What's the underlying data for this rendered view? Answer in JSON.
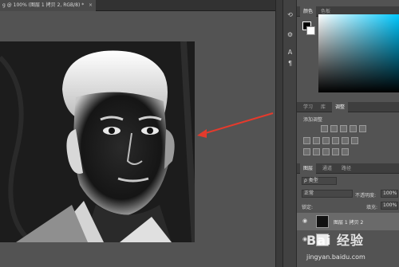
{
  "document": {
    "tab_title": "g @ 100% (图层 1 拷贝 2, RGB/8) *",
    "close_glyph": "×"
  },
  "colors": {
    "accent_arrow": "#e53a2c",
    "workspace": "#535353",
    "panel_dark": "#3e3e3e"
  },
  "color_panel": {
    "tabs": [
      "颜色",
      "色板"
    ],
    "active_tab": 0
  },
  "adjust_panel": {
    "tabs": [
      "学习",
      "库",
      "调整"
    ],
    "active_tab": 2,
    "add_label": "添加调整"
  },
  "layers_panel": {
    "tabs": [
      "图层",
      "通道",
      "路径"
    ],
    "active_tab": 0,
    "filter_label": "ρ 类型",
    "blend_mode": "正常",
    "opacity_label": "不透明度:",
    "opacity_value": "100%",
    "lock_label": "锁定:",
    "fill_label": "填充:",
    "fill_value": "100%",
    "layers": [
      {
        "name": "图层 1 拷贝 2",
        "selected": true
      },
      {
        "name": "",
        "selected": false
      }
    ]
  },
  "side_tools": [
    "history-icon",
    "paragraph-settings-icon",
    "character-icon",
    "paragraph-icon"
  ],
  "watermark": {
    "text": "Bai 经验",
    "sub": "jingyan.baidu.com"
  }
}
